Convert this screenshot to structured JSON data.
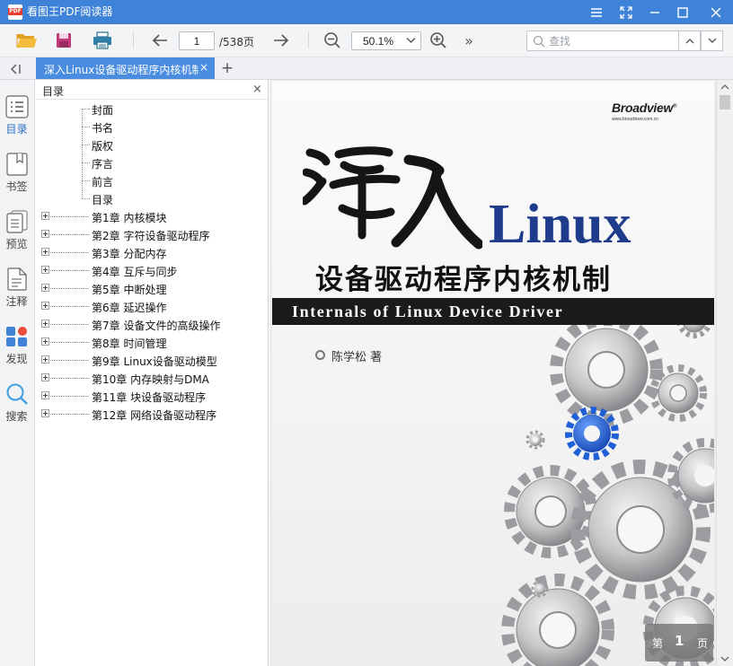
{
  "window": {
    "app_title": "看图王PDF阅读器",
    "app_icon_text": "PDF",
    "controls": [
      "menu-icon",
      "fullscreen-icon",
      "minimize-icon",
      "maximize-icon",
      "close-icon"
    ]
  },
  "toolbar": {
    "current_page": "1",
    "total_pages": "/538页",
    "zoom": "50.1%",
    "search_placeholder": "查找",
    "more": "»"
  },
  "tabs": [
    {
      "label": "深入Linux设备驱动程序内核机制",
      "close": "×",
      "active": true
    }
  ],
  "tab_add": "+",
  "rail": [
    {
      "label": "目录",
      "icon": "toc-list-icon",
      "active": true
    },
    {
      "label": "书签",
      "icon": "bookmark-icon",
      "active": false
    },
    {
      "label": "预览",
      "icon": "thumbnail-preview-icon",
      "active": false
    },
    {
      "label": "注释",
      "icon": "annotation-icon",
      "active": false
    },
    {
      "label": "发现",
      "icon": "discover-apps-icon",
      "active": false
    },
    {
      "label": "搜索",
      "icon": "search-icon",
      "active": false
    }
  ],
  "toc": {
    "title": "目录",
    "close": "×",
    "items": [
      {
        "label": "封面",
        "expandable": false
      },
      {
        "label": "书名",
        "expandable": false
      },
      {
        "label": "版权",
        "expandable": false
      },
      {
        "label": "序言",
        "expandable": false
      },
      {
        "label": "前言",
        "expandable": false
      },
      {
        "label": "目录",
        "expandable": false
      },
      {
        "label": "第1章 内核模块",
        "expandable": true
      },
      {
        "label": "第2章 字符设备驱动程序",
        "expandable": true
      },
      {
        "label": "第3章 分配内存",
        "expandable": true
      },
      {
        "label": "第4章 互斥与同步",
        "expandable": true
      },
      {
        "label": "第5章 中断处理",
        "expandable": true
      },
      {
        "label": "第6章 延迟操作",
        "expandable": true
      },
      {
        "label": "第7章 设备文件的高级操作",
        "expandable": true
      },
      {
        "label": "第8章 时间管理",
        "expandable": true
      },
      {
        "label": "第9章 Linux设备驱动模型",
        "expandable": true
      },
      {
        "label": "第10章 内存映射与DMA",
        "expandable": true
      },
      {
        "label": "第11章 块设备驱动程序",
        "expandable": true
      },
      {
        "label": "第12章 网络设备驱动程序",
        "expandable": true
      }
    ]
  },
  "cover": {
    "publisher": "Broadview",
    "publisher_registered": "®",
    "publisher_url": "www.broadview.com.cn",
    "title_calligraphy": "深入",
    "title_linux": "Linux",
    "subtitle": "设备驱动程序内核机制",
    "english_title": "Internals of Linux Device Driver",
    "author": "陈学松 著"
  },
  "page_indicator": {
    "prefix": "第",
    "number": "1",
    "suffix": "页"
  },
  "colors": {
    "titlebar": "#3f83d9",
    "active_tab": "#4a8de0",
    "accent_blue": "#2f6fc4",
    "cover_linux": "#1f3b8c",
    "gear_blue": "#1f5fd8"
  }
}
